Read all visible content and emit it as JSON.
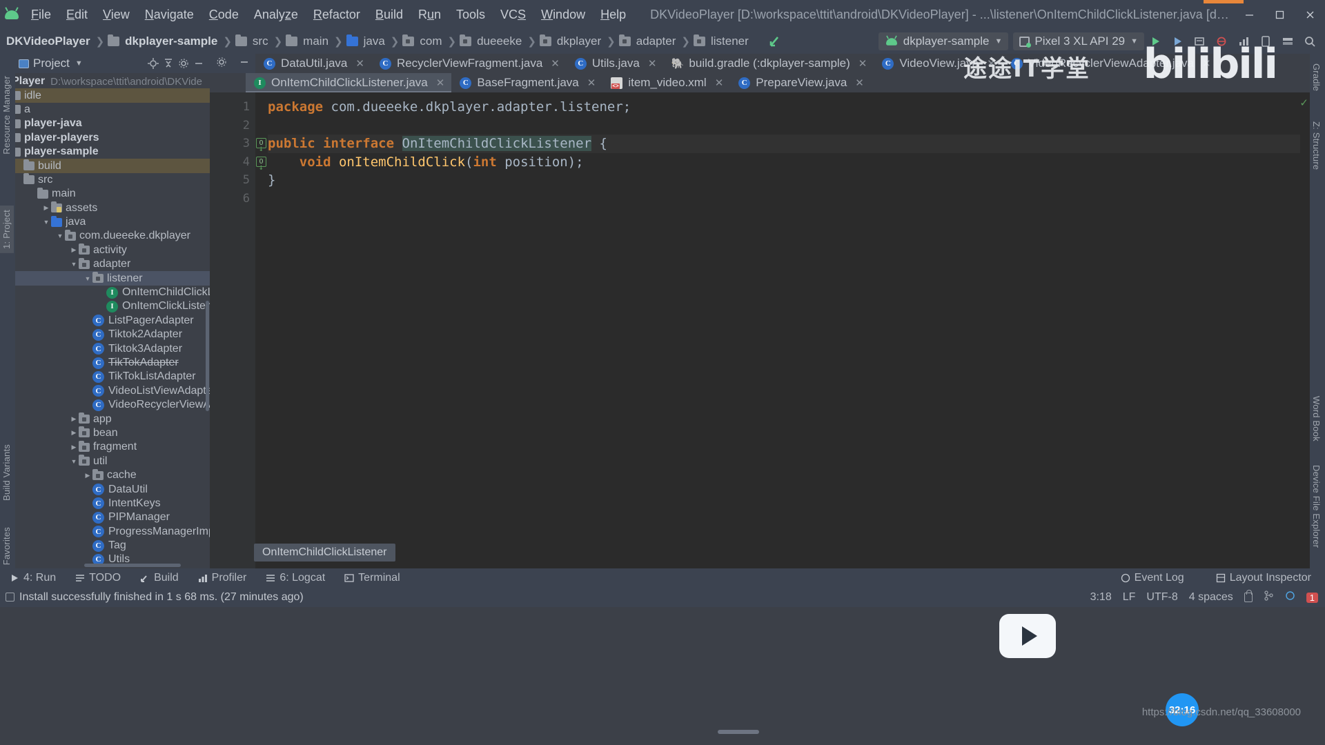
{
  "window": {
    "title": "DKVideoPlayer [D:\\workspace\\ttit\\android\\DKVideoPlayer] - ...\\listener\\OnItemChildClickListener.java [dkplayer-sample]",
    "app_icon": "android-logo-icon",
    "minimize": "minimize-icon",
    "maximize": "maximize-icon",
    "close": "close-icon"
  },
  "menu": [
    {
      "label": "File"
    },
    {
      "label": "Edit"
    },
    {
      "label": "View"
    },
    {
      "label": "Navigate"
    },
    {
      "label": "Code"
    },
    {
      "label": "Analyze"
    },
    {
      "label": "Refactor"
    },
    {
      "label": "Build"
    },
    {
      "label": "Run"
    },
    {
      "label": "Tools"
    },
    {
      "label": "VCS"
    },
    {
      "label": "Window"
    },
    {
      "label": "Help"
    }
  ],
  "breadcrumb": [
    {
      "label": "DKVideoPlayer",
      "icon": "none"
    },
    {
      "label": "dkplayer-sample",
      "icon": "module-icon"
    },
    {
      "label": "src",
      "icon": "folder-icon"
    },
    {
      "label": "main",
      "icon": "folder-icon"
    },
    {
      "label": "java",
      "icon": "source-folder-icon"
    },
    {
      "label": "com",
      "icon": "package-icon"
    },
    {
      "label": "dueeeke",
      "icon": "package-icon"
    },
    {
      "label": "dkplayer",
      "icon": "package-icon"
    },
    {
      "label": "adapter",
      "icon": "package-icon"
    },
    {
      "label": "listener",
      "icon": "package-icon"
    }
  ],
  "toolbar": {
    "run_config": "dkplayer-sample",
    "device": "Pixel 3 XL API 29",
    "icons": [
      "make-project-icon",
      "sync-gradle-icon",
      "avd-manager-icon",
      "sdk-manager-icon",
      "run-icon",
      "debug-icon",
      "profile-icon",
      "attach-debugger-icon",
      "search-icon",
      "layout-inspector-icon"
    ]
  },
  "left_strip": [
    {
      "label": "Resource Manager",
      "selected": false
    },
    {
      "label": "1: Project",
      "selected": true
    },
    {
      "label": "Build Variants",
      "selected": false
    },
    {
      "label": "2: Favorites",
      "selected": false
    }
  ],
  "right_strip": [
    {
      "label": "Gradle"
    },
    {
      "label": "Z: Structure"
    },
    {
      "label": "Word Book"
    },
    {
      "label": "Device File Explorer"
    }
  ],
  "project_panel": {
    "title": "Project",
    "dropdown_icon": "chevron-down-icon",
    "locate_icon": "locate-icon",
    "collapse_icon": "collapse-all-icon",
    "settings_icon": "gear-icon",
    "hide_icon": "hide-icon"
  },
  "tree": [
    {
      "label": "leoPlayer",
      "path": "D:\\workspace\\ttit\\android\\DKVide",
      "indent": 0,
      "type": "project-root",
      "bold": true
    },
    {
      "label": "idle",
      "indent": 1,
      "type": "folder",
      "modified": true
    },
    {
      "label": "a",
      "indent": 1,
      "type": "folder"
    },
    {
      "label": "player-java",
      "indent": 1,
      "type": "module",
      "bold": true
    },
    {
      "label": "player-players",
      "indent": 1,
      "type": "module",
      "bold": true
    },
    {
      "label": "player-sample",
      "indent": 1,
      "type": "module",
      "bold": true
    },
    {
      "label": "build",
      "indent": 2,
      "type": "folder",
      "modified": true
    },
    {
      "label": "src",
      "indent": 2,
      "type": "folder"
    },
    {
      "label": "main",
      "indent": 3,
      "type": "folder"
    },
    {
      "label": "assets",
      "indent": 4,
      "type": "assets-folder",
      "twist": "collapsed"
    },
    {
      "label": "java",
      "indent": 4,
      "type": "source-folder",
      "twist": "expanded"
    },
    {
      "label": "com.dueeeke.dkplayer",
      "indent": 5,
      "type": "package",
      "twist": "expanded"
    },
    {
      "label": "activity",
      "indent": 6,
      "type": "package",
      "twist": "collapsed"
    },
    {
      "label": "adapter",
      "indent": 6,
      "type": "package",
      "twist": "expanded"
    },
    {
      "label": "listener",
      "indent": 7,
      "type": "package",
      "twist": "expanded",
      "selected": true
    },
    {
      "label": "OnItemChildClickListener",
      "indent": 8,
      "type": "interface"
    },
    {
      "label": "OnItemClickListener",
      "indent": 8,
      "type": "interface"
    },
    {
      "label": "ListPagerAdapter",
      "indent": 7,
      "type": "class"
    },
    {
      "label": "Tiktok2Adapter",
      "indent": 7,
      "type": "class"
    },
    {
      "label": "Tiktok3Adapter",
      "indent": 7,
      "type": "class"
    },
    {
      "label": "TikTokAdapter",
      "indent": 7,
      "type": "class",
      "strike": true
    },
    {
      "label": "TikTokListAdapter",
      "indent": 7,
      "type": "class"
    },
    {
      "label": "VideoListViewAdapter",
      "indent": 7,
      "type": "class"
    },
    {
      "label": "VideoRecyclerViewAdapter",
      "indent": 7,
      "type": "class"
    },
    {
      "label": "app",
      "indent": 6,
      "type": "package",
      "twist": "collapsed"
    },
    {
      "label": "bean",
      "indent": 6,
      "type": "package",
      "twist": "collapsed"
    },
    {
      "label": "fragment",
      "indent": 6,
      "type": "package",
      "twist": "collapsed"
    },
    {
      "label": "util",
      "indent": 6,
      "type": "package",
      "twist": "expanded"
    },
    {
      "label": "cache",
      "indent": 7,
      "type": "package",
      "twist": "collapsed"
    },
    {
      "label": "DataUtil",
      "indent": 7,
      "type": "class"
    },
    {
      "label": "IntentKeys",
      "indent": 7,
      "type": "class"
    },
    {
      "label": "PIPManager",
      "indent": 7,
      "type": "class"
    },
    {
      "label": "ProgressManagerImpl",
      "indent": 7,
      "type": "class"
    },
    {
      "label": "Tag",
      "indent": 7,
      "type": "class"
    },
    {
      "label": "Utils",
      "indent": 7,
      "type": "class"
    }
  ],
  "editor_tabs_row1": [
    {
      "label": "DataUtil.java",
      "icon": "java-class-icon",
      "active": false
    },
    {
      "label": "RecyclerViewFragment.java",
      "icon": "java-class-icon",
      "active": false
    },
    {
      "label": "Utils.java",
      "icon": "java-class-icon",
      "active": false
    },
    {
      "label": "build.gradle (:dkplayer-sample)",
      "icon": "gradle-icon",
      "active": false
    },
    {
      "label": "VideoView.java",
      "icon": "java-class-icon",
      "active": false
    },
    {
      "label": "VideoRecyclerViewAdapter.java",
      "icon": "java-class-icon",
      "active": false
    }
  ],
  "editor_tabs_row2": [
    {
      "label": "OnItemChildClickListener.java",
      "icon": "java-interface-icon",
      "active": true
    },
    {
      "label": "BaseFragment.java",
      "icon": "java-class-icon",
      "active": false
    },
    {
      "label": "item_video.xml",
      "icon": "xml-layout-icon",
      "active": false
    },
    {
      "label": "PrepareView.java",
      "icon": "java-class-icon",
      "active": false
    }
  ],
  "code": {
    "lines": [
      {
        "n": "1",
        "tokens": [
          {
            "t": "package",
            "c": "kw"
          },
          {
            "t": " com.dueeeke.dkplayer.adapter.listener;",
            "c": "plain"
          }
        ]
      },
      {
        "n": "2",
        "tokens": [
          {
            "t": "",
            "c": "plain"
          }
        ]
      },
      {
        "n": "3",
        "gutter_mark": "implemented-icon",
        "highlight": true,
        "tokens": [
          {
            "t": "public",
            "c": "kw"
          },
          {
            "t": " ",
            "c": "plain"
          },
          {
            "t": "interface",
            "c": "kw"
          },
          {
            "t": " ",
            "c": "plain"
          },
          {
            "t": "OnItemChildClickListener",
            "c": "sel"
          },
          {
            "t": " {",
            "c": "plain"
          }
        ]
      },
      {
        "n": "4",
        "gutter_mark": "implemented-icon",
        "tokens": [
          {
            "t": "    ",
            "c": "plain"
          },
          {
            "t": "void",
            "c": "kw"
          },
          {
            "t": " ",
            "c": "plain"
          },
          {
            "t": "onItemChildClick",
            "c": "ident"
          },
          {
            "t": "(",
            "c": "plain"
          },
          {
            "t": "int",
            "c": "kw"
          },
          {
            "t": " position);",
            "c": "plain"
          }
        ]
      },
      {
        "n": "5",
        "tokens": [
          {
            "t": "}",
            "c": "plain"
          }
        ]
      },
      {
        "n": "6",
        "tokens": [
          {
            "t": "",
            "c": "plain"
          }
        ]
      }
    ],
    "hint_popup": "OnItemChildClickListener",
    "inspection_status": "ok-check-icon"
  },
  "bottom_bar": {
    "items": [
      {
        "label": "4: Run",
        "icon": "run-icon"
      },
      {
        "label": "TODO",
        "icon": "todo-icon"
      },
      {
        "label": "Build",
        "icon": "build-icon"
      },
      {
        "label": "Profiler",
        "icon": "profiler-icon"
      },
      {
        "label": "6: Logcat",
        "icon": "logcat-icon"
      },
      {
        "label": "Terminal",
        "icon": "terminal-icon"
      }
    ],
    "right": [
      {
        "label": "Event Log",
        "icon": "event-log-icon"
      },
      {
        "label": "Layout Inspector",
        "icon": "layout-inspector-icon"
      }
    ]
  },
  "status_bar": {
    "message": "Install successfully finished in 1 s 68 ms. (27 minutes ago)",
    "caret": "3:18",
    "line_sep": "LF",
    "encoding": "UTF-8",
    "indent": "4 spaces",
    "lock_icon": "lock-icon",
    "branch_icon": "git-branch-icon",
    "error_badge": "1"
  },
  "overlays": {
    "watermark_text": "途途IT学堂",
    "watermark_brand": "bilibili",
    "watermark_logo": "play-button-logo",
    "timer_badge": "32:16",
    "url": "https://blog.csdn.net/qq_33608000"
  },
  "colors": {
    "accent_orange": "#e8873a",
    "android_green": "#5ec98a",
    "selection_blue": "#4b5364",
    "modified_brown": "#5d5540",
    "class_icon": "#2f6cc4",
    "interface_icon": "#1f8a5e",
    "editor_bg": "#2b2b2b",
    "keyword": "#cc7832",
    "method": "#ffc66d"
  }
}
